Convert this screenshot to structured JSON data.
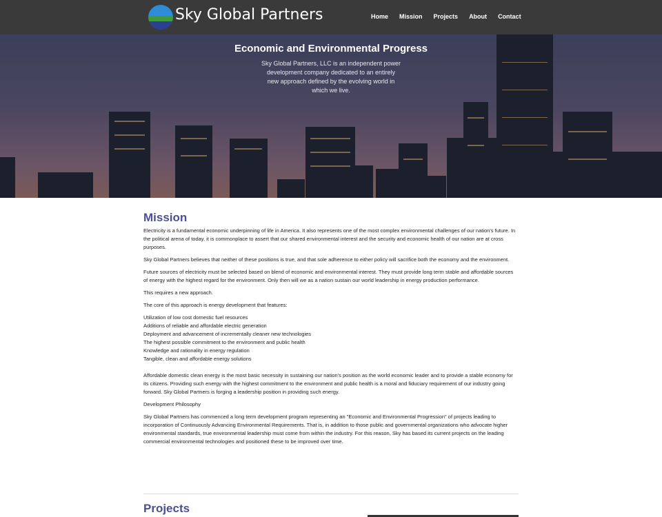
{
  "brand": {
    "name": "Sky Global Partners"
  },
  "nav": [
    {
      "label": "Home"
    },
    {
      "label": "Mission"
    },
    {
      "label": "Projects"
    },
    {
      "label": "About"
    },
    {
      "label": "Contact"
    }
  ],
  "hero": {
    "title": "Economic and Environmental Progress",
    "subtitle": "Sky Global Partners, LLC is an independent power development company dedicated to an entirely new approach defined by the evolving world in which we live."
  },
  "mission": {
    "title": "Mission",
    "paragraphs": [
      "Electricity is a fundamental economic underpinning of life in America.  It also represents one of the most complex environmental challenges of our nation's future.  In the political arena of today, it is commonplace to assert that our shared environmental interest and the security and economic health of our nation are at cross purposes.",
      "Sky Global Partners believes that neither of these positions is true, and that sole adherence to either policy will sacrifice both the economy and the environment.",
      "Future sources of electricity must be selected based on blend of economic and environmental interest.  They must provide long term stable and affordable sources of energy with the highest regard for the environment.  Only then will we as a nation sustain our world leadership in energy production performance.",
      "This requires a new approach.",
      "The core of this approach is energy development that features:"
    ],
    "features": [
      "Utilization of low cost domestic fuel resources",
      "Additions of reliable and affordable electric generation",
      "Deployment and advancement of incrementally cleaner new technologies",
      "The highest possible commitment to the environment and public health",
      "Knowledge and rationality in energy regulation",
      "Tangible, clean and affordable energy solutions"
    ],
    "closing": [
      "Affordable domestic clean energy is the most basic necessity in sustaining our nation's position as the world economic leader and to provide a stable economy for its citizens.  Providing such energy with the highest commitment to the environment and public health is a moral and fiduciary requirement of our industry going forward.  Sky Global Partners is forging a leadership position in providing such energy.",
      "Development Philosophy",
      "Sky Global Partners has commenced a long term development program representing an \"Economic and Environmental Progression\" of projects leading to incorporation of Continuously Advancing Environmental Requirements.  That is, in addition to those public and governmental organizations who advocate higher environmental standards, true environmental leadership must come from within the industry.  For this reason, Sky has based its current projects on the leading commercial environmental technologies and positioned these to be improved over time."
    ]
  },
  "projects": {
    "title": "Projects"
  }
}
